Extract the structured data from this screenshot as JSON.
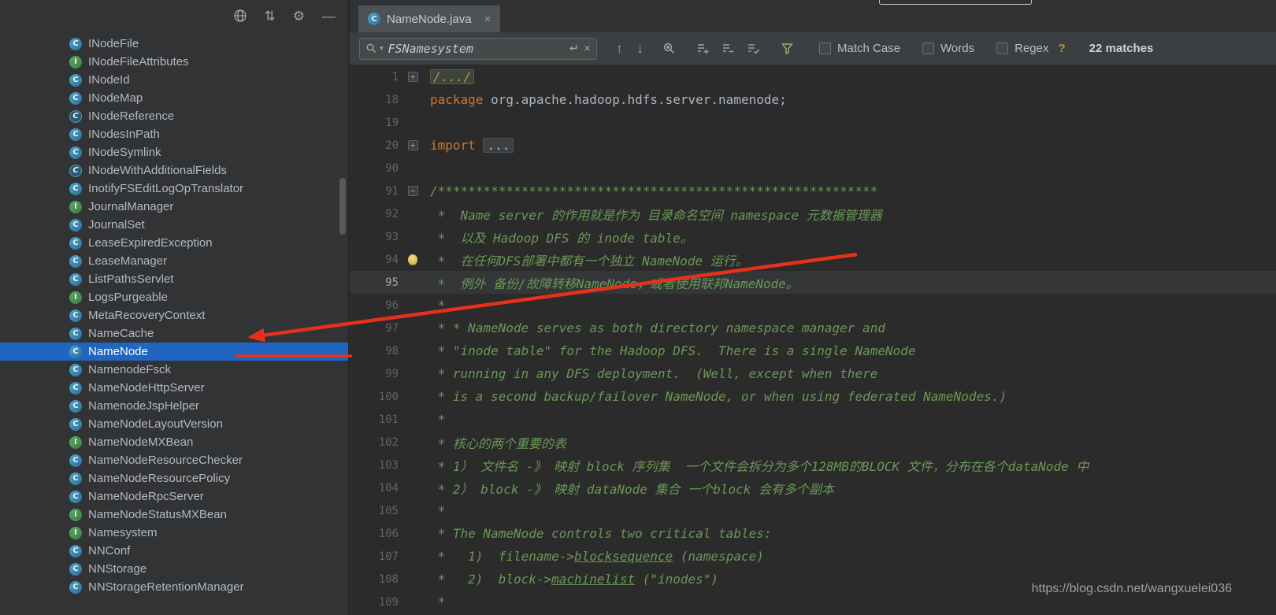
{
  "tab": {
    "title": "NameNode.java",
    "close_glyph": "×"
  },
  "toolbar": {
    "scroll_glyph": "⇅",
    "gear_glyph": "⚙",
    "hide_glyph": "—"
  },
  "search": {
    "query": "FSNamesystem",
    "options_arrow": "▾",
    "prev_glyph": "↑",
    "next_glyph": "↓",
    "clear_glyph": "×",
    "options": [
      {
        "label": "Match Case",
        "checked": false
      },
      {
        "label": "Words",
        "checked": false
      },
      {
        "label": "Regex",
        "checked": false
      }
    ],
    "help_glyph": "?",
    "matches": "22 matches"
  },
  "icons": {
    "left_toolbar": [
      "globe-icon",
      "scroll-from-source-icon",
      "settings-gear-icon",
      "hide-panel-icon"
    ],
    "find_bar": [
      "search-icon",
      "search-options-arrow-icon",
      "newline-icon",
      "clear-search-icon",
      "prev-occurrence-icon",
      "next-occurrence-icon",
      "find-all-icon",
      "add-selection-icon",
      "unselect-occurrence-icon",
      "select-all-occurrences-icon",
      "filter-icon"
    ],
    "gutter": [
      "fold-expand-icon",
      "fold-collapse-icon",
      "intention-bulb-icon"
    ],
    "fold_expand_glyph": "+",
    "fold_collapse_glyph": "−"
  },
  "colors": {
    "selection_blue": "#2065c0",
    "comment_green": "#699856",
    "keyword_orange": "#cc7832",
    "arrow_red": "#e5311c",
    "class_icon_blue": "#2b6f96",
    "interface_icon_green": "#3a7d44"
  },
  "sidebar": {
    "items": [
      {
        "label": "INodeFile",
        "icon": "class",
        "selected": false
      },
      {
        "label": "INodeFileAttributes",
        "icon": "interface",
        "selected": false
      },
      {
        "label": "INodeId",
        "icon": "class",
        "selected": false
      },
      {
        "label": "INodeMap",
        "icon": "class",
        "selected": false
      },
      {
        "label": "INodeReference",
        "icon": "abstract-class",
        "selected": false
      },
      {
        "label": "INodesInPath",
        "icon": "class",
        "selected": false
      },
      {
        "label": "INodeSymlink",
        "icon": "class",
        "selected": false
      },
      {
        "label": "INodeWithAdditionalFields",
        "icon": "abstract-class",
        "selected": false
      },
      {
        "label": "InotifyFSEditLogOpTranslator",
        "icon": "class",
        "selected": false
      },
      {
        "label": "JournalManager",
        "icon": "interface",
        "selected": false
      },
      {
        "label": "JournalSet",
        "icon": "class",
        "selected": false
      },
      {
        "label": "LeaseExpiredException",
        "icon": "class",
        "selected": false
      },
      {
        "label": "LeaseManager",
        "icon": "class",
        "selected": false
      },
      {
        "label": "ListPathsServlet",
        "icon": "class",
        "selected": false
      },
      {
        "label": "LogsPurgeable",
        "icon": "interface",
        "selected": false
      },
      {
        "label": "MetaRecoveryContext",
        "icon": "class",
        "selected": false
      },
      {
        "label": "NameCache",
        "icon": "class",
        "selected": false
      },
      {
        "label": "NameNode",
        "icon": "class",
        "selected": true
      },
      {
        "label": "NamenodeFsck",
        "icon": "class",
        "selected": false
      },
      {
        "label": "NameNodeHttpServer",
        "icon": "class",
        "selected": false
      },
      {
        "label": "NamenodeJspHelper",
        "icon": "class",
        "selected": false
      },
      {
        "label": "NameNodeLayoutVersion",
        "icon": "class",
        "selected": false
      },
      {
        "label": "NameNodeMXBean",
        "icon": "interface",
        "selected": false
      },
      {
        "label": "NameNodeResourceChecker",
        "icon": "class",
        "selected": false
      },
      {
        "label": "NameNodeResourcePolicy",
        "icon": "class",
        "selected": false
      },
      {
        "label": "NameNodeRpcServer",
        "icon": "class",
        "selected": false
      },
      {
        "label": "NameNodeStatusMXBean",
        "icon": "interface",
        "selected": false
      },
      {
        "label": "Namesystem",
        "icon": "interface",
        "selected": false
      },
      {
        "label": "NNConf",
        "icon": "class",
        "selected": false
      },
      {
        "label": "NNStorage",
        "icon": "class",
        "selected": false
      },
      {
        "label": "NNStorageRetentionManager",
        "icon": "class",
        "selected": false
      }
    ]
  },
  "editor": {
    "lines": [
      {
        "num": "1",
        "fold": "plus",
        "segs": [
          {
            "t": "/.../",
            "c": "foldc"
          }
        ]
      },
      {
        "num": "18",
        "segs": [
          {
            "t": "package ",
            "c": "kw"
          },
          {
            "t": "org.apache.hadoop.hdfs.server.namenode;",
            "c": "plain"
          }
        ]
      },
      {
        "num": "19",
        "segs": []
      },
      {
        "num": "20",
        "fold": "plus",
        "segs": [
          {
            "t": "import ",
            "c": "kw"
          },
          {
            "t": "...",
            "c": "foldp"
          }
        ]
      },
      {
        "num": "90",
        "segs": []
      },
      {
        "num": "91",
        "fold": "minus",
        "segs": [
          {
            "t": "/**********************************************************",
            "c": "cmt"
          }
        ]
      },
      {
        "num": "92",
        "segs": [
          {
            "t": " *  Name server 的作用就是作为 目录命名空间 namespace 元数据管理器",
            "c": "cmt"
          }
        ]
      },
      {
        "num": "93",
        "segs": [
          {
            "t": " *  以及 Hadoop DFS 的 inode table。",
            "c": "cmt"
          }
        ]
      },
      {
        "num": "94",
        "bulb": true,
        "segs": [
          {
            "t": " *  在任何DFS部署中都有一个独立 NameNode 运行。",
            "c": "cmt"
          }
        ]
      },
      {
        "num": "95",
        "current": true,
        "segs": [
          {
            "t": " *  例外 备份/故障转移NameNode，或者使用联邦NameNode。",
            "c": "cmt"
          }
        ]
      },
      {
        "num": "96",
        "segs": [
          {
            "t": " *",
            "c": "cmt"
          }
        ]
      },
      {
        "num": "97",
        "segs": [
          {
            "t": " * * NameNode serves as both directory namespace manager and",
            "c": "cmt"
          }
        ]
      },
      {
        "num": "98",
        "segs": [
          {
            "t": " * \"inode table\" for the Hadoop DFS.  There is a single NameNode",
            "c": "cmt"
          }
        ]
      },
      {
        "num": "99",
        "segs": [
          {
            "t": " * running in any DFS deployment.  (Well, except when there",
            "c": "cmt"
          }
        ]
      },
      {
        "num": "100",
        "segs": [
          {
            "t": " * is a second backup/failover NameNode, or when using federated NameNodes.)",
            "c": "cmt"
          }
        ]
      },
      {
        "num": "101",
        "segs": [
          {
            "t": " *",
            "c": "cmt"
          }
        ]
      },
      {
        "num": "102",
        "segs": [
          {
            "t": " * 核心的两个重要的表",
            "c": "cmt"
          }
        ]
      },
      {
        "num": "103",
        "segs": [
          {
            "t": " * 1） 文件名 -》 映射 block 序列集  一个文件会拆分为多个128MB的BLOCK 文件，分布在各个dataNode 中",
            "c": "cmt"
          }
        ]
      },
      {
        "num": "104",
        "segs": [
          {
            "t": " * 2） block -》 映射 dataNode 集合 一个block 会有多个副本",
            "c": "cmt"
          }
        ]
      },
      {
        "num": "105",
        "segs": [
          {
            "t": " *",
            "c": "cmt"
          }
        ]
      },
      {
        "num": "106",
        "segs": [
          {
            "t": " * The NameNode controls two critical tables:",
            "c": "cmt"
          }
        ]
      },
      {
        "num": "107",
        "segs": [
          {
            "t": " *   1)  filename->",
            "c": "cmt"
          },
          {
            "t": "blocksequence",
            "c": "cmtu"
          },
          {
            "t": " (namespace)",
            "c": "cmt"
          }
        ]
      },
      {
        "num": "108",
        "segs": [
          {
            "t": " *   2)  block->",
            "c": "cmt"
          },
          {
            "t": "machinelist",
            "c": "cmtu"
          },
          {
            "t": " (\"inodes\")",
            "c": "cmt"
          }
        ]
      },
      {
        "num": "109",
        "segs": [
          {
            "t": " *",
            "c": "cmt"
          }
        ]
      }
    ]
  },
  "watermark": "https://blog.csdn.net/wangxuelei036"
}
